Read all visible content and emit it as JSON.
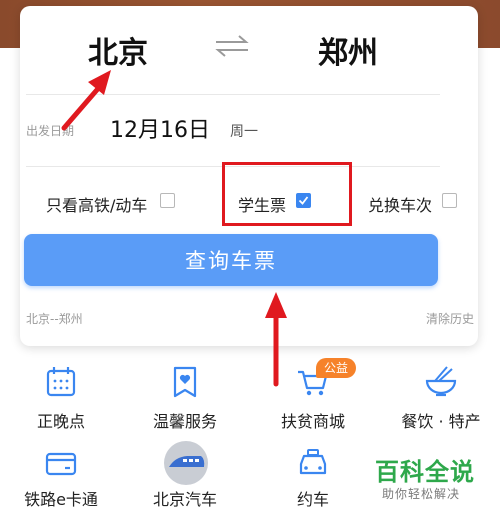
{
  "route": {
    "from_city": "北京",
    "to_city": "郑州",
    "swap_icon": "swap-arrows-icon"
  },
  "date": {
    "label": "出发日期",
    "value": "12月16日",
    "weekday": "周一"
  },
  "options": {
    "high_speed_label": "只看高铁/动车",
    "high_speed_checked": false,
    "student_label": "学生票",
    "student_checked": true,
    "exchange_label": "兑换车次",
    "exchange_checked": false
  },
  "search_button": "查询车票",
  "history": {
    "item": "北京--郑州",
    "clear_label": "清除历史"
  },
  "menu": {
    "row1": [
      {
        "label": "正晚点",
        "icon": "calendar-icon"
      },
      {
        "label": "温馨服务",
        "icon": "heart-bookmark-icon"
      },
      {
        "label": "扶贫商城",
        "icon": "shopping-cart-icon",
        "badge": "公益"
      },
      {
        "label": "餐饮 · 特产",
        "icon": "noodle-bowl-icon"
      }
    ],
    "row2": [
      {
        "label": "铁路e卡通",
        "icon": "card-icon"
      },
      {
        "label": "北京汽车",
        "icon": "bus-icon"
      },
      {
        "label": "约车",
        "icon": "taxi-icon"
      }
    ]
  },
  "watermark": {
    "main": "百科全说",
    "sub": "助你轻松解决"
  },
  "colors": {
    "accent": "#3a86f0",
    "button": "#5a9cf7",
    "annotation": "#e0191f",
    "badge": "#f6822a",
    "watermark": "#2ea84b"
  }
}
